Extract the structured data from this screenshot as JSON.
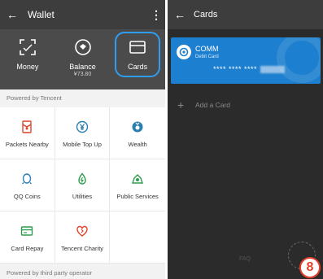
{
  "wallet": {
    "title": "Wallet",
    "top_items": [
      {
        "label": "Money",
        "icon": "scan-icon"
      },
      {
        "label": "Balance",
        "sub": "¥73.80",
        "icon": "coin-icon"
      },
      {
        "label": "Cards",
        "icon": "card-icon"
      }
    ],
    "powered_label": "Powered by Tencent",
    "services": [
      {
        "label": "Packets Nearby",
        "icon": "red-packet-icon"
      },
      {
        "label": "Mobile Top Up",
        "icon": "yen-phone-icon"
      },
      {
        "label": "Wealth",
        "icon": "wealth-icon"
      },
      {
        "label": "QQ Coins",
        "icon": "qq-icon"
      },
      {
        "label": "Utilities",
        "icon": "utilities-icon"
      },
      {
        "label": "Public Services",
        "icon": "public-services-icon"
      },
      {
        "label": "Card Repay",
        "icon": "card-repay-icon"
      },
      {
        "label": "Tencent Charity",
        "icon": "charity-heart-icon"
      }
    ],
    "third_party_label": "Powered by third party operator"
  },
  "cards": {
    "title": "Cards",
    "card": {
      "bank": "COMM",
      "type": "Debit Card",
      "number": "**** **** ****"
    },
    "add_card_label": "Add a Card",
    "faq_label": "FAQ"
  },
  "badge": {
    "number": "8"
  },
  "colors": {
    "accent_blue": "#2f9ef2",
    "card_blue": "#1d7fcf",
    "badge_red": "#e2412b",
    "icon_red": "#e2412b",
    "icon_green": "#2e9c4e",
    "icon_teal": "#2a7fb0"
  }
}
